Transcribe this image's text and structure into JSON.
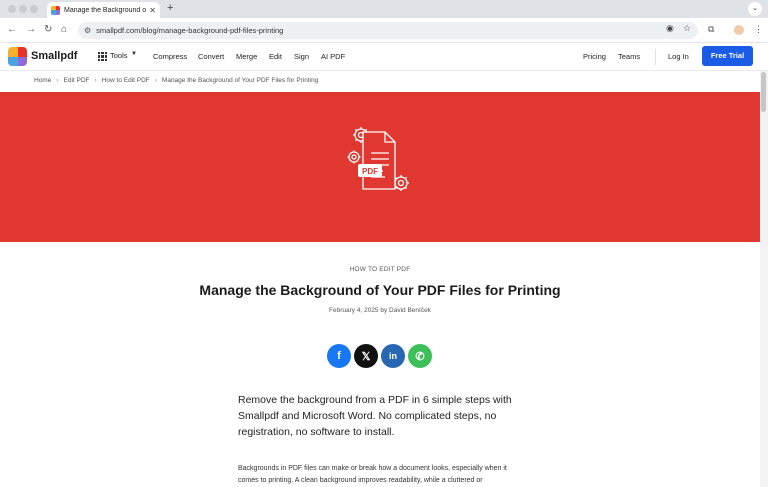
{
  "browser": {
    "tab_title": "Manage the Background of Yo",
    "tab_close": "✕",
    "new_tab": "+",
    "url": "smallpdf.com/blog/manage-background-pdf-files-printing"
  },
  "site": {
    "brand": "Smallpdf",
    "brand_colors": [
      "#f5b02e",
      "#e5322d",
      "#4ba3e3",
      "#8e6ad8"
    ],
    "nav": {
      "tools": "Tools",
      "compress": "Compress",
      "convert": "Convert",
      "merge": "Merge",
      "edit": "Edit",
      "sign": "Sign",
      "ai_pdf": "AI PDF",
      "pricing": "Pricing",
      "teams": "Teams",
      "login": "Log In",
      "free_trial": "Free Trial"
    },
    "accent_color": "#1b5ce6"
  },
  "breadcrumb": {
    "home": "Home",
    "edit_pdf": "Edit PDF",
    "how_to": "How to Edit PDF",
    "current": "Manage the Background of Your PDF Files for Printing"
  },
  "hero": {
    "background_color": "#e03831",
    "badge": "PDF"
  },
  "article": {
    "category": "HOW TO EDIT PDF",
    "title": "Manage the Background of Your PDF Files for Printing",
    "byline": "February 4, 2025 by David Beníček",
    "share": {
      "facebook": "f",
      "x": "𝕏",
      "linkedin": "in",
      "whatsapp": "✆"
    },
    "lead": "Remove the background from a PDF in 6 simple steps with Smallpdf and Microsoft Word. No complicated steps, no registration, no software to install.",
    "body": "Backgrounds in PDF files can make or break how a document looks, especially when it comes to printing. A clean background improves readability, while a cluttered or"
  }
}
